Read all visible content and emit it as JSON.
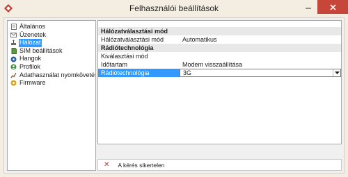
{
  "window": {
    "title": "Felhasználói beállítások"
  },
  "tree": [
    {
      "label": "Általános",
      "icon": "document-icon",
      "selected": false
    },
    {
      "label": "Üzenetek",
      "icon": "envelope-icon",
      "selected": false
    },
    {
      "label": "Hálózat",
      "icon": "network-icon",
      "selected": true
    },
    {
      "label": "SIM beállítások",
      "icon": "sim-card-icon",
      "selected": false
    },
    {
      "label": "Hangok",
      "icon": "speaker-icon",
      "selected": false
    },
    {
      "label": "Profilok",
      "icon": "profile-icon",
      "selected": false
    },
    {
      "label": "Adathasználat nyomkövetése",
      "icon": "data-usage-icon",
      "selected": false
    },
    {
      "label": "Firmware",
      "icon": "firmware-icon",
      "selected": false
    }
  ],
  "grid": {
    "sections": [
      {
        "title": "Hálózatválasztási mód",
        "rows": [
          {
            "key": "Hálózatválasztási mód",
            "value": "Automatikus"
          }
        ]
      },
      {
        "title": "Rádiótechnológia",
        "rows": [
          {
            "key": "Kiválasztási mód",
            "value": ""
          },
          {
            "key": "Időtartam",
            "value": "Modem visszaállítása"
          },
          {
            "key": "Rádiótechnológia",
            "value": "3G"
          }
        ]
      }
    ]
  },
  "status": {
    "icon": "error-x-icon",
    "message": "A kérés sikertelen"
  },
  "colors": {
    "selection": "#3399ff",
    "close_button": "#c7463a",
    "error": "#c0392b"
  }
}
